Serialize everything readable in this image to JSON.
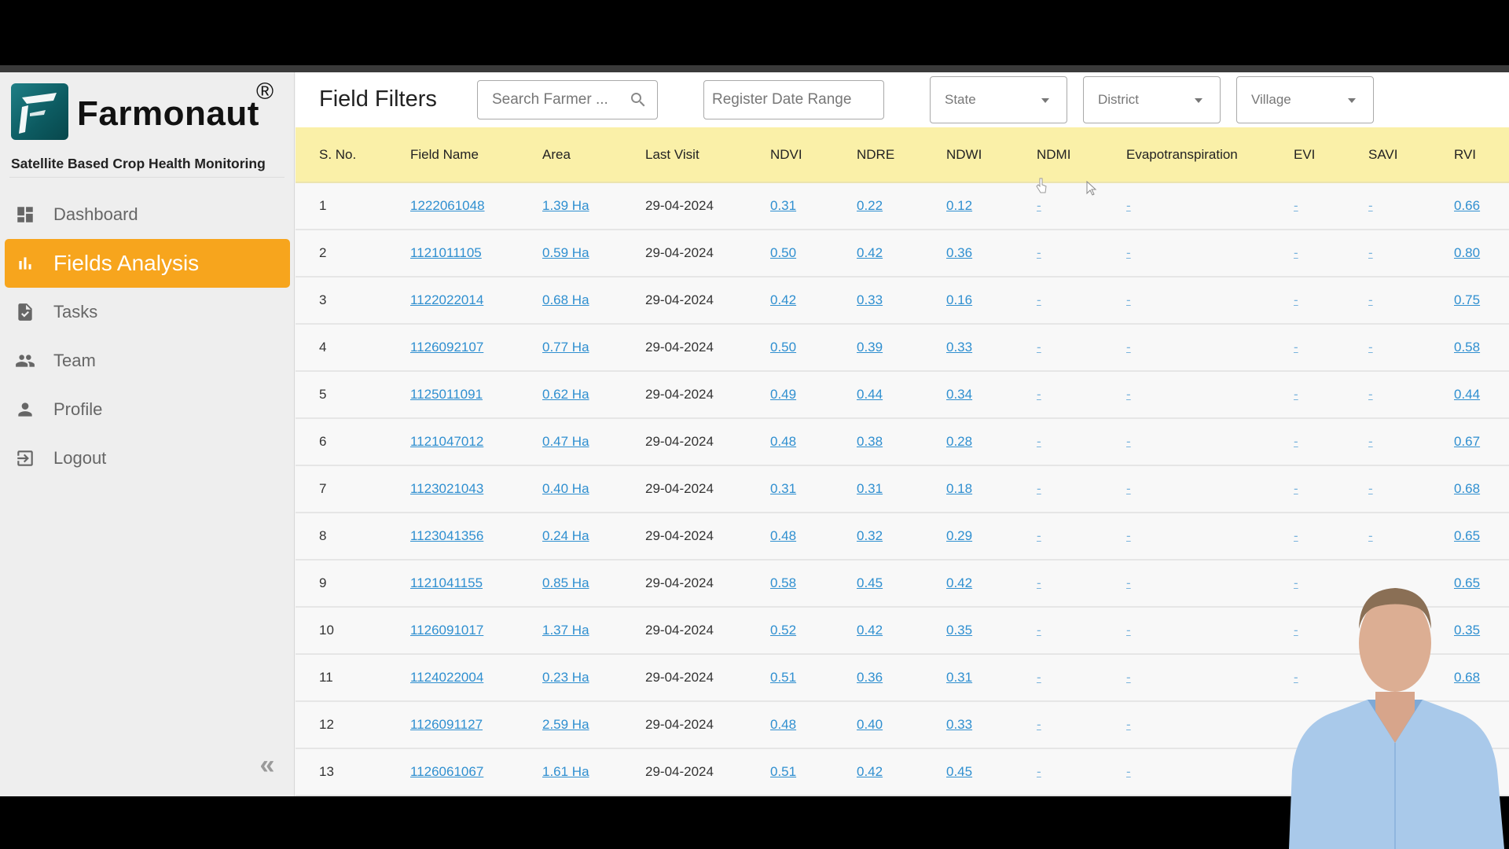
{
  "brand": {
    "name": "Farmonaut",
    "registered_mark": "®",
    "tagline": "Satellite Based Crop Health Monitoring"
  },
  "sidebar": {
    "items": [
      {
        "label": "Dashboard",
        "icon": "dashboard-icon",
        "active": false
      },
      {
        "label": "Fields Analysis",
        "icon": "bar-chart-icon",
        "active": true
      },
      {
        "label": "Tasks",
        "icon": "task-icon",
        "active": false
      },
      {
        "label": "Team",
        "icon": "team-icon",
        "active": false
      },
      {
        "label": "Profile",
        "icon": "person-icon",
        "active": false
      },
      {
        "label": "Logout",
        "icon": "logout-icon",
        "active": false
      }
    ],
    "collapse_label": "«"
  },
  "filters": {
    "title": "Field Filters",
    "search_placeholder": "Search Farmer ...",
    "date_placeholder": "Register Date Range",
    "state_label": "State",
    "district_label": "District",
    "village_label": "Village"
  },
  "table": {
    "columns": [
      "S. No.",
      "Field Name",
      "Area",
      "Last Visit",
      "NDVI",
      "NDRE",
      "NDWI",
      "NDMI",
      "Evapotranspiration",
      "EVI",
      "SAVI",
      "RVI"
    ],
    "rows": [
      [
        "1",
        "1222061048",
        "1.39 Ha",
        "29-04-2024",
        "0.31",
        "0.22",
        "0.12",
        "-",
        "-",
        "-",
        "-",
        "0.66"
      ],
      [
        "2",
        "1121011105",
        "0.59 Ha",
        "29-04-2024",
        "0.50",
        "0.42",
        "0.36",
        "-",
        "-",
        "-",
        "-",
        "0.80"
      ],
      [
        "3",
        "1122022014",
        "0.68 Ha",
        "29-04-2024",
        "0.42",
        "0.33",
        "0.16",
        "-",
        "-",
        "-",
        "-",
        "0.75"
      ],
      [
        "4",
        "1126092107",
        "0.77 Ha",
        "29-04-2024",
        "0.50",
        "0.39",
        "0.33",
        "-",
        "-",
        "-",
        "-",
        "0.58"
      ],
      [
        "5",
        "1125011091",
        "0.62 Ha",
        "29-04-2024",
        "0.49",
        "0.44",
        "0.34",
        "-",
        "-",
        "-",
        "-",
        "0.44"
      ],
      [
        "6",
        "1121047012",
        "0.47 Ha",
        "29-04-2024",
        "0.48",
        "0.38",
        "0.28",
        "-",
        "-",
        "-",
        "-",
        "0.67"
      ],
      [
        "7",
        "1123021043",
        "0.40 Ha",
        "29-04-2024",
        "0.31",
        "0.31",
        "0.18",
        "-",
        "-",
        "-",
        "-",
        "0.68"
      ],
      [
        "8",
        "1123041356",
        "0.24 Ha",
        "29-04-2024",
        "0.48",
        "0.32",
        "0.29",
        "-",
        "-",
        "-",
        "-",
        "0.65"
      ],
      [
        "9",
        "1121041155",
        "0.85 Ha",
        "29-04-2024",
        "0.58",
        "0.45",
        "0.42",
        "-",
        "-",
        "-",
        "",
        "0.65"
      ],
      [
        "10",
        "1126091017",
        "1.37 Ha",
        "29-04-2024",
        "0.52",
        "0.42",
        "0.35",
        "-",
        "-",
        "-",
        "",
        "0.35"
      ],
      [
        "11",
        "1124022004",
        "0.23 Ha",
        "29-04-2024",
        "0.51",
        "0.36",
        "0.31",
        "-",
        "-",
        "-",
        "",
        "0.68"
      ],
      [
        "12",
        "1126091127",
        "2.59 Ha",
        "29-04-2024",
        "0.48",
        "0.40",
        "0.33",
        "-",
        "-",
        "",
        "",
        ""
      ],
      [
        "13",
        "1126061067",
        "1.61 Ha",
        "29-04-2024",
        "0.51",
        "0.42",
        "0.45",
        "-",
        "-",
        "",
        "",
        ""
      ]
    ]
  },
  "colors": {
    "accent": "#f7a51d",
    "table_header": "#faf0a8",
    "link": "#2f8fd0",
    "logo": "#0c5a60"
  }
}
